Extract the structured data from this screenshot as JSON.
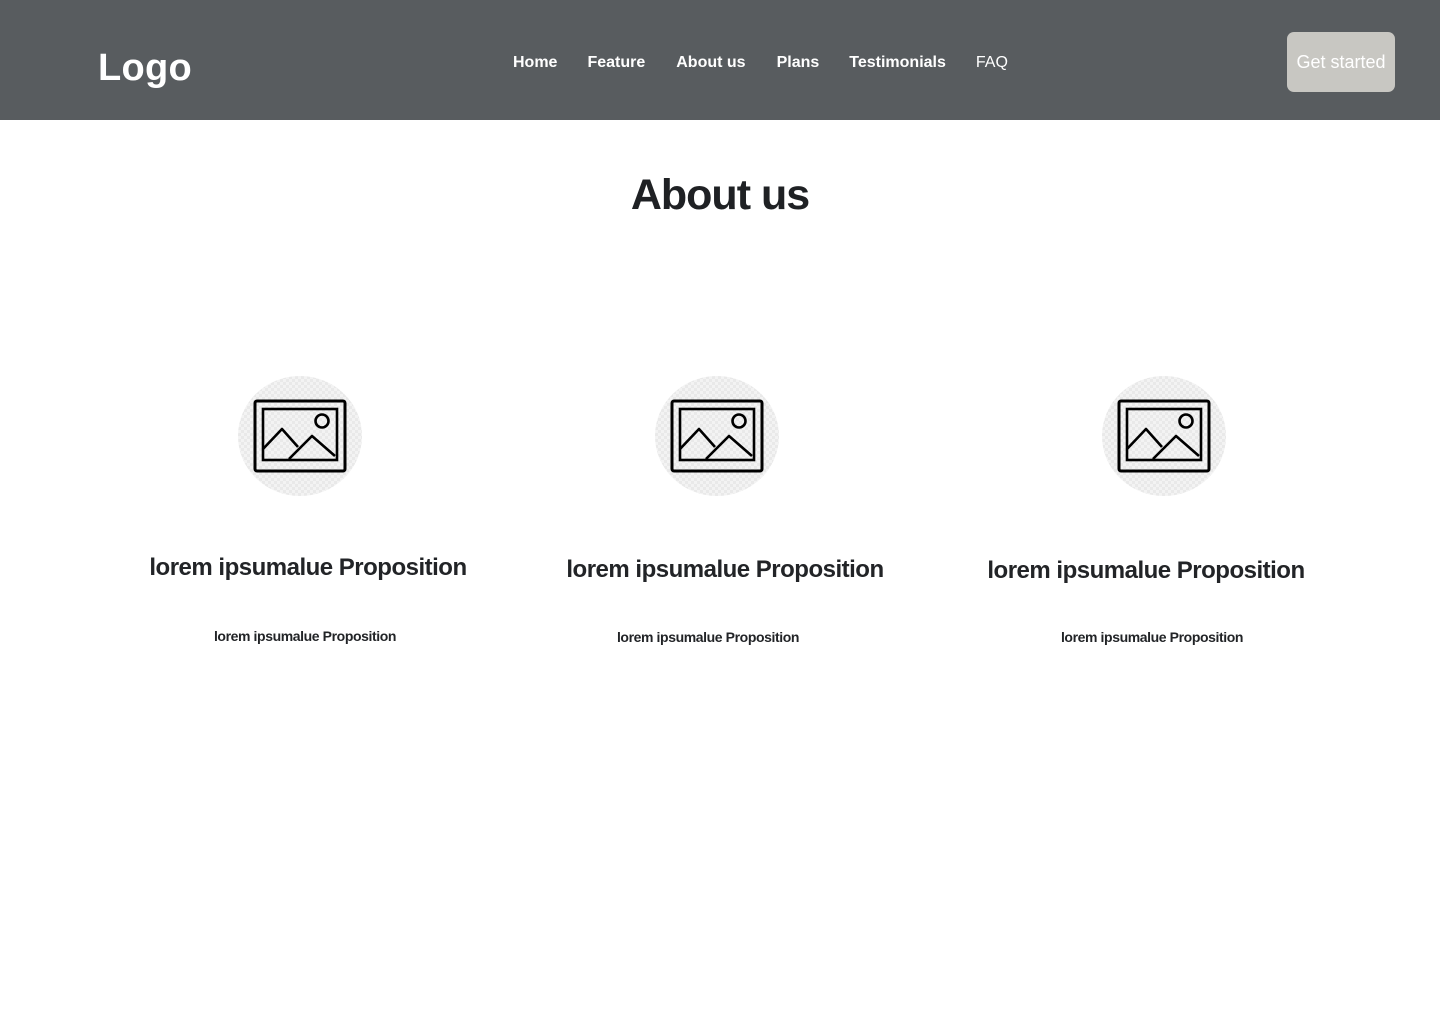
{
  "header": {
    "logo": "Logo",
    "nav": [
      "Home",
      "Feature",
      "About us",
      "Plans",
      "Testimonials",
      "FAQ"
    ],
    "cta_label": "Get started",
    "background": "#585c5f",
    "cta_background": "#c8c7c2"
  },
  "about": {
    "title": "About us",
    "cards": [
      {
        "icon": "image-placeholder-icon",
        "title": "lorem ipsumalue Proposition",
        "text": "lorem ipsumalue Proposition"
      },
      {
        "icon": "image-placeholder-icon",
        "title": "lorem ipsumalue Proposition",
        "text": "lorem ipsumalue Proposition"
      },
      {
        "icon": "image-placeholder-icon",
        "title": "lorem ipsumalue Proposition",
        "text": "lorem ipsumalue Proposition"
      }
    ]
  }
}
